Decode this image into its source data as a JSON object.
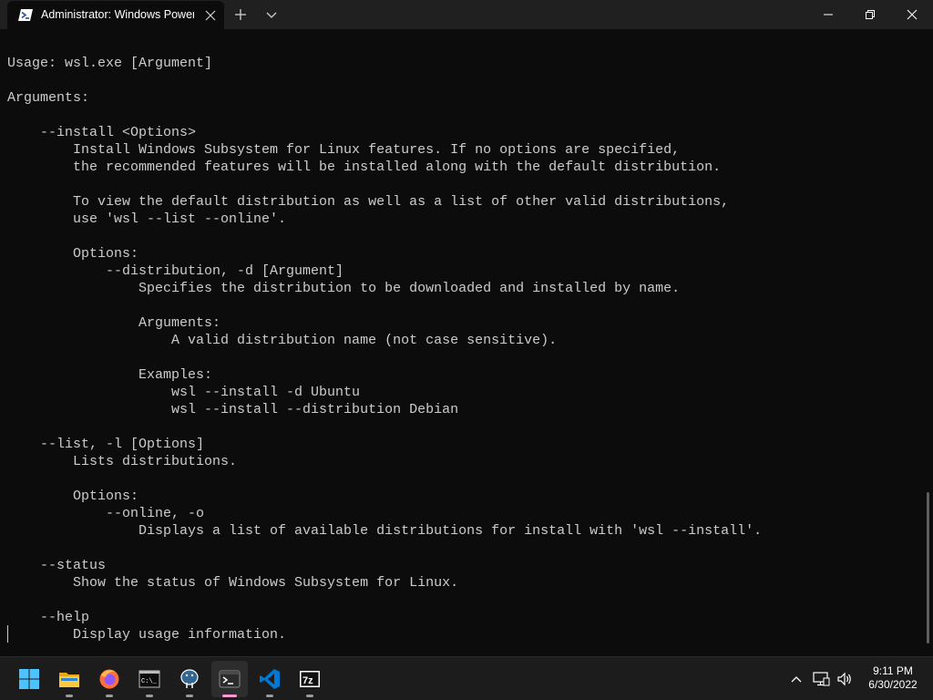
{
  "window": {
    "tab_title": "Administrator: Windows PowerShell",
    "tab_icon": "powershell-icon",
    "new_tab_icon": "plus-icon",
    "dropdown_icon": "chevron-down-icon",
    "controls": [
      "minimize-icon",
      "restore-icon",
      "close-icon"
    ]
  },
  "terminal": {
    "lines": [
      "Usage: wsl.exe [Argument]",
      "",
      "Arguments:",
      "",
      "    --install <Options>",
      "        Install Windows Subsystem for Linux features. If no options are specified,",
      "        the recommended features will be installed along with the default distribution.",
      "",
      "        To view the default distribution as well as a list of other valid distributions,",
      "        use 'wsl --list --online'.",
      "",
      "        Options:",
      "            --distribution, -d [Argument]",
      "                Specifies the distribution to be downloaded and installed by name.",
      "",
      "                Arguments:",
      "                    A valid distribution name (not case sensitive).",
      "",
      "                Examples:",
      "                    wsl --install -d Ubuntu",
      "                    wsl --install --distribution Debian",
      "",
      "    --list, -l [Options]",
      "        Lists distributions.",
      "",
      "        Options:",
      "            --online, -o",
      "                Displays a list of available distributions for install with 'wsl --install'.",
      "",
      "    --status",
      "        Show the status of Windows Subsystem for Linux.",
      "",
      "    --help",
      "        Display usage information."
    ]
  },
  "taskbar": {
    "apps": [
      {
        "name": "start-button",
        "icon": "windows-logo-icon",
        "running": false
      },
      {
        "name": "file-explorer",
        "icon": "folder-icon",
        "running": true
      },
      {
        "name": "firefox",
        "icon": "firefox-icon",
        "running": true
      },
      {
        "name": "command-prompt",
        "icon": "cmd-icon",
        "running": true
      },
      {
        "name": "pgadmin",
        "icon": "elephant-icon",
        "running": true
      },
      {
        "name": "windows-terminal",
        "icon": "terminal-icon",
        "running": true,
        "active": true
      },
      {
        "name": "vscode",
        "icon": "vscode-icon",
        "running": true
      },
      {
        "name": "7zip",
        "icon": "7zip-icon",
        "running": true
      }
    ],
    "tray_icons": [
      "chevron-up-icon",
      "network-icon",
      "volume-icon"
    ],
    "clock_time": "9:11 PM",
    "clock_date": "6/30/2022"
  },
  "colors": {
    "terminal_bg": "#0c0c0c",
    "terminal_fg": "#cccccc",
    "titlebar_bg": "#202020",
    "taskbar_bg": "#1c1c1c",
    "active_indicator": "#ff99d6"
  }
}
